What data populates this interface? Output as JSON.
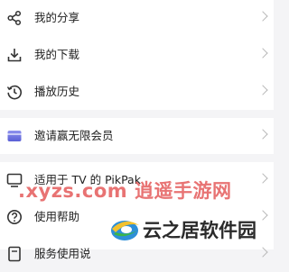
{
  "menu": {
    "group1": [
      {
        "label": "我的分享",
        "icon": "share-icon"
      },
      {
        "label": "我的下载",
        "icon": "download-icon"
      },
      {
        "label": "播放历史",
        "icon": "history-icon"
      }
    ],
    "group2": [
      {
        "label": "邀请赢无限会员",
        "icon": "membership-card-icon"
      }
    ],
    "group3": [
      {
        "label": "适用于 TV 的 PikPak",
        "icon": "tv-icon"
      },
      {
        "label": "使用帮助",
        "icon": "help-icon"
      },
      {
        "label": "服务使用说",
        "icon": "document-icon"
      }
    ]
  },
  "watermarks": {
    "site": ".xyzs.com 逍遥手游网",
    "brand": "云之居软件园"
  },
  "colors": {
    "accent_purple": "#6a6fe0",
    "watermark_red": "#e14b4b"
  }
}
